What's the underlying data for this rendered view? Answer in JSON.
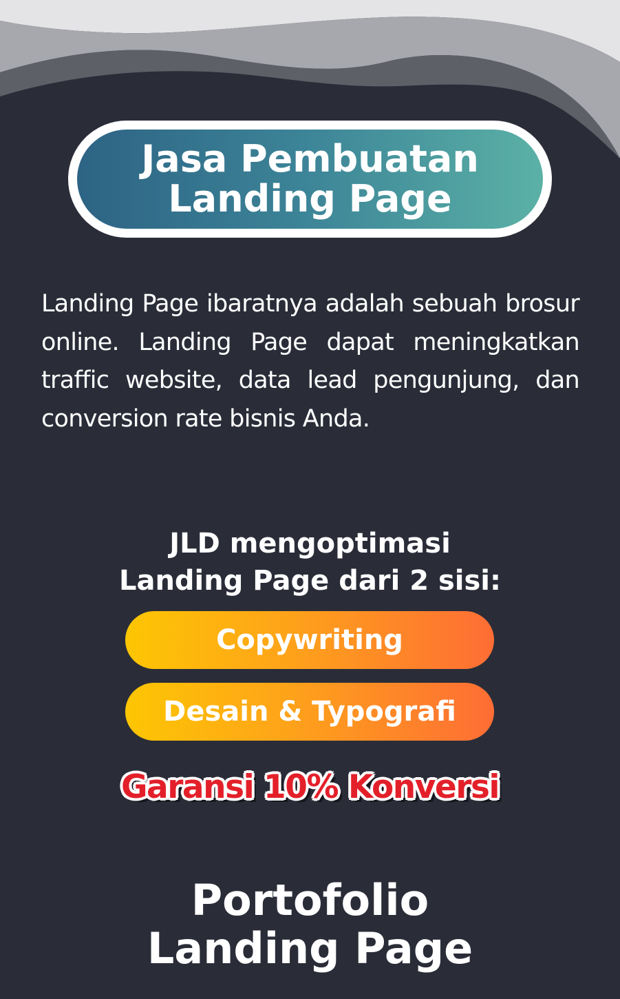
{
  "hero": {
    "line1": "Jasa Pembuatan",
    "line2": "Landing Page"
  },
  "description": "Landing Page ibaratnya adalah sebuah brosur online. Landing Page dapat meningkatkan traffic website, data lead pengunjung, dan conversion rate bisnis Anda.",
  "optimize": {
    "line1": "JLD mengoptimasi",
    "line2": "Landing Page dari 2 sisi:"
  },
  "features": [
    {
      "label": "Copywriting"
    },
    {
      "label": "Desain & Typografi"
    }
  ],
  "guarantee": "Garansi 10% Konversi",
  "portfolio": {
    "line1": "Portofolio",
    "line2": "Landing Page"
  },
  "colors": {
    "background": "#2a2d38",
    "hero_gradient_start": "#2d6384",
    "hero_gradient_end": "#5bb1a6",
    "feature_gradient_start": "#fdc603",
    "feature_gradient_end": "#fe6d35",
    "guarantee_red": "#e3202a",
    "text": "#ffffff"
  }
}
